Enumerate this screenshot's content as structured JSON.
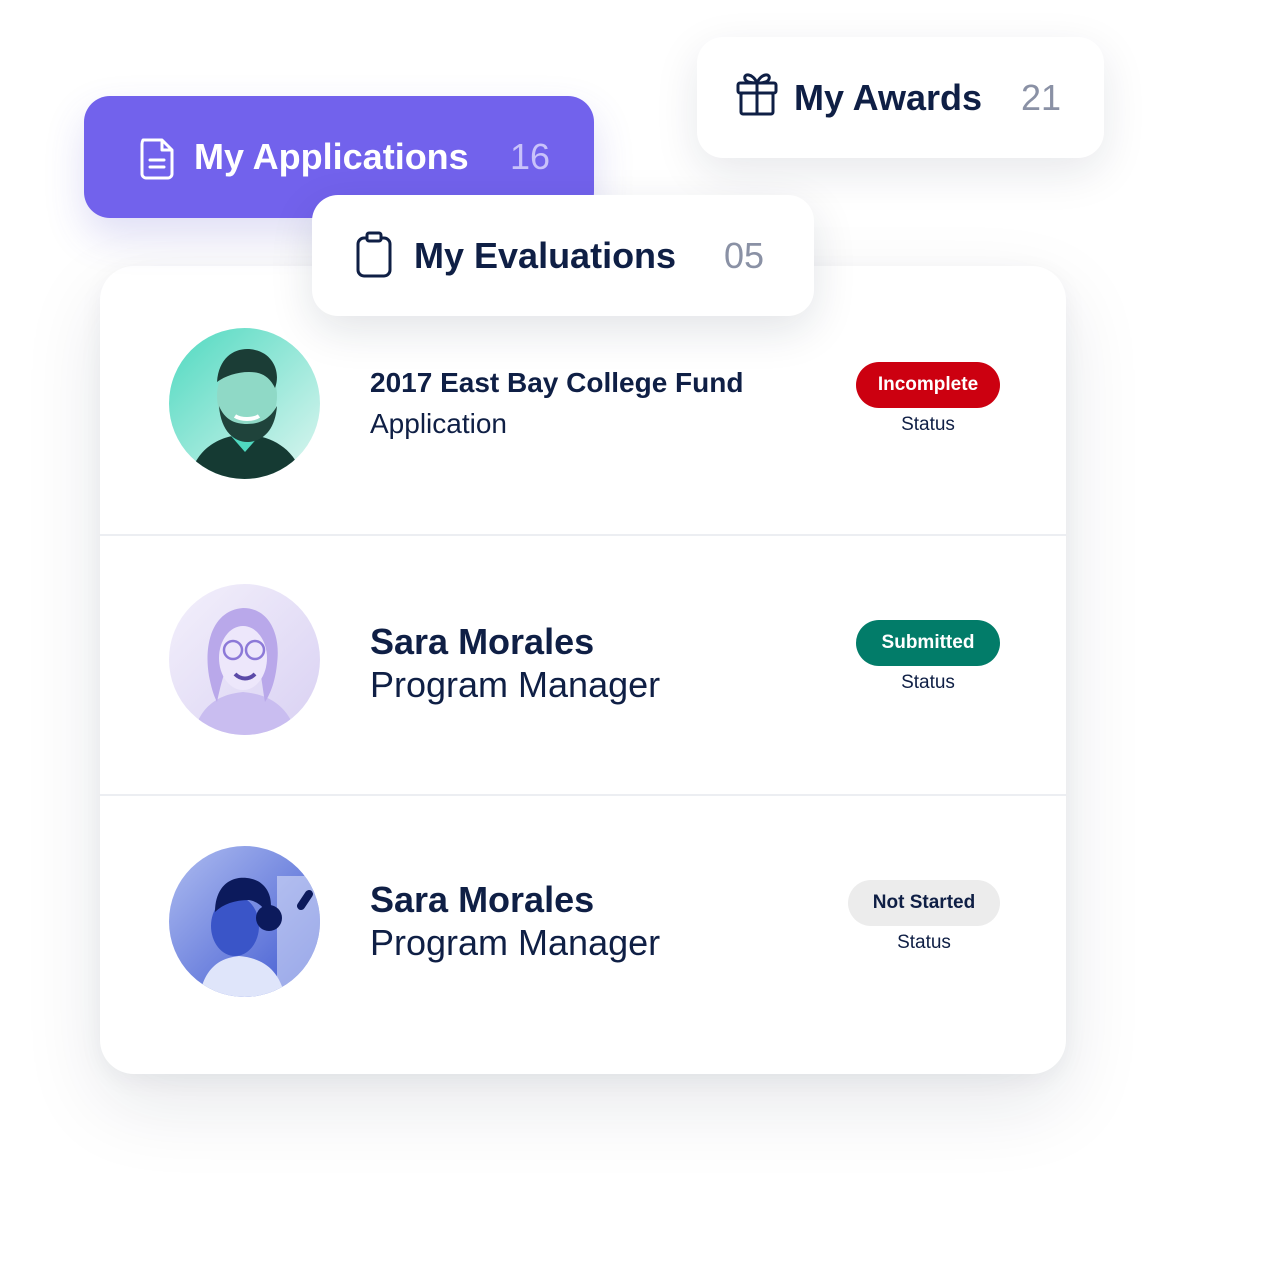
{
  "tabs": {
    "applications": {
      "label": "My Applications",
      "count": "16",
      "icon": "document-icon",
      "active": true
    },
    "awards": {
      "label": "My Awards",
      "count": "21",
      "icon": "gift-icon"
    },
    "evaluations": {
      "label": "My Evaluations",
      "count": "05",
      "icon": "clipboard-icon"
    }
  },
  "items": [
    {
      "title": "2017 East Bay College Fund",
      "subtitle": "Application",
      "status": "Incomplete",
      "status_caption": "Status",
      "status_color": "#cc0010",
      "avatar_tint": "#35c8b4"
    },
    {
      "title": "Sara Morales",
      "subtitle": "Program Manager",
      "status": "Submitted",
      "status_caption": "Status",
      "status_color": "#027c69",
      "avatar_tint": "#8f7ce0"
    },
    {
      "title": "Sara Morales",
      "subtitle": "Program Manager",
      "status": "Not Started",
      "status_caption": "Status",
      "status_color": "#ececec",
      "avatar_tint": "#2d46c8"
    }
  ]
}
